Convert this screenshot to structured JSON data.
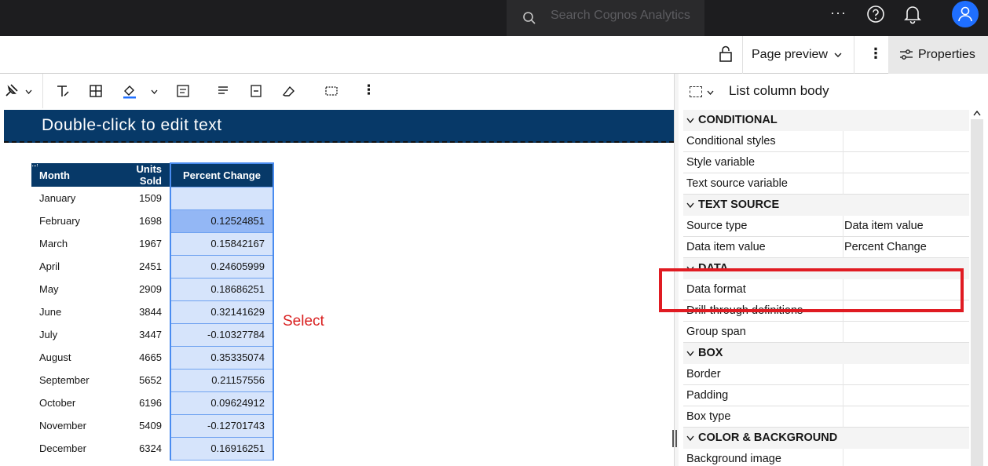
{
  "topbar": {
    "search_placeholder": "Search Cognos Analytics",
    "more_label": "···",
    "icons": [
      "search-icon",
      "help-icon",
      "notification-icon",
      "user-avatar-icon"
    ]
  },
  "toolbar2": {
    "page_preview_label": "Page preview",
    "properties_label": "Properties"
  },
  "canvas": {
    "header_text": "Double-click to edit text",
    "table": {
      "headers": [
        "Month",
        "Units Sold",
        "Percent Change"
      ],
      "rows": [
        {
          "month": "January",
          "units": "1509",
          "pct": ""
        },
        {
          "month": "February",
          "units": "1698",
          "pct": "0.12524851"
        },
        {
          "month": "March",
          "units": "1967",
          "pct": "0.15842167"
        },
        {
          "month": "April",
          "units": "2451",
          "pct": "0.24605999"
        },
        {
          "month": "May",
          "units": "2909",
          "pct": "0.18686251"
        },
        {
          "month": "June",
          "units": "3844",
          "pct": "0.32141629"
        },
        {
          "month": "July",
          "units": "3447",
          "pct": "-0.10327784"
        },
        {
          "month": "August",
          "units": "4665",
          "pct": "0.35335074"
        },
        {
          "month": "September",
          "units": "5652",
          "pct": "0.21157556"
        },
        {
          "month": "October",
          "units": "6196",
          "pct": "0.09624912"
        },
        {
          "month": "November",
          "units": "5409",
          "pct": "-0.12701743"
        },
        {
          "month": "December",
          "units": "6324",
          "pct": "0.16916251"
        }
      ]
    },
    "annotation": "Select"
  },
  "panel": {
    "title": "List column body",
    "sections": [
      {
        "type": "section",
        "label": "CONDITIONAL"
      },
      {
        "type": "row",
        "label": "Conditional styles",
        "value": ""
      },
      {
        "type": "row",
        "label": "Style variable",
        "value": ""
      },
      {
        "type": "row",
        "label": "Text source variable",
        "value": ""
      },
      {
        "type": "section",
        "label": "TEXT SOURCE"
      },
      {
        "type": "row",
        "label": "Source type",
        "value": "Data item value"
      },
      {
        "type": "row",
        "label": "Data item value",
        "value": "Percent Change"
      },
      {
        "type": "section",
        "label": "DATA"
      },
      {
        "type": "row",
        "label": "Data format",
        "value": ""
      },
      {
        "type": "row",
        "label": "Drill-through definitions",
        "value": ""
      },
      {
        "type": "row",
        "label": "Group span",
        "value": ""
      },
      {
        "type": "section",
        "label": "BOX"
      },
      {
        "type": "row",
        "label": "Border",
        "value": ""
      },
      {
        "type": "row",
        "label": "Padding",
        "value": ""
      },
      {
        "type": "row",
        "label": "Box type",
        "value": ""
      },
      {
        "type": "section",
        "label": "COLOR & BACKGROUND"
      },
      {
        "type": "row",
        "label": "Background image",
        "value": ""
      }
    ]
  },
  "colors": {
    "topbar": "#1d1d1f",
    "header_banner": "#073968",
    "selection": "#d6e4fb",
    "selection_border": "#4a8cf0",
    "annotation": "#e01b22"
  }
}
